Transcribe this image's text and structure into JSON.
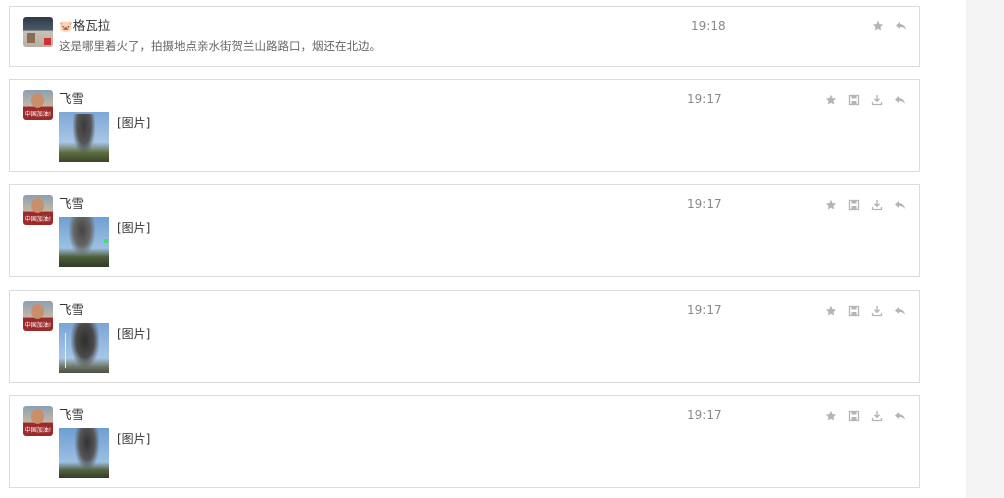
{
  "messages": [
    {
      "sender": "格瓦拉",
      "sender_emoji": "🐷",
      "time": "19:18",
      "text": "这是哪里着火了，拍摄地点亲水街贺兰山路路口，烟还在北边。",
      "actions": [
        "star-icon",
        "reply-icon"
      ]
    },
    {
      "sender": "飞雪",
      "time": "19:17",
      "image_label": "[图片]",
      "actions": [
        "star-icon",
        "save-icon",
        "download-icon",
        "reply-icon"
      ]
    },
    {
      "sender": "飞雪",
      "time": "19:17",
      "image_label": "[图片]",
      "actions": [
        "star-icon",
        "save-icon",
        "download-icon",
        "reply-icon"
      ]
    },
    {
      "sender": "飞雪",
      "time": "19:17",
      "image_label": "[图片]",
      "actions": [
        "star-icon",
        "save-icon",
        "download-icon",
        "reply-icon"
      ]
    },
    {
      "sender": "飞雪",
      "time": "19:17",
      "image_label": "[图片]",
      "actions": [
        "star-icon",
        "save-icon",
        "download-icon",
        "reply-icon"
      ]
    }
  ],
  "avatar_badge_text": "中国加油!",
  "colors": {
    "border": "#dcdcdc",
    "icon": "#b5b5b5",
    "time": "#888888",
    "sidebar": "#f4f4f5"
  }
}
